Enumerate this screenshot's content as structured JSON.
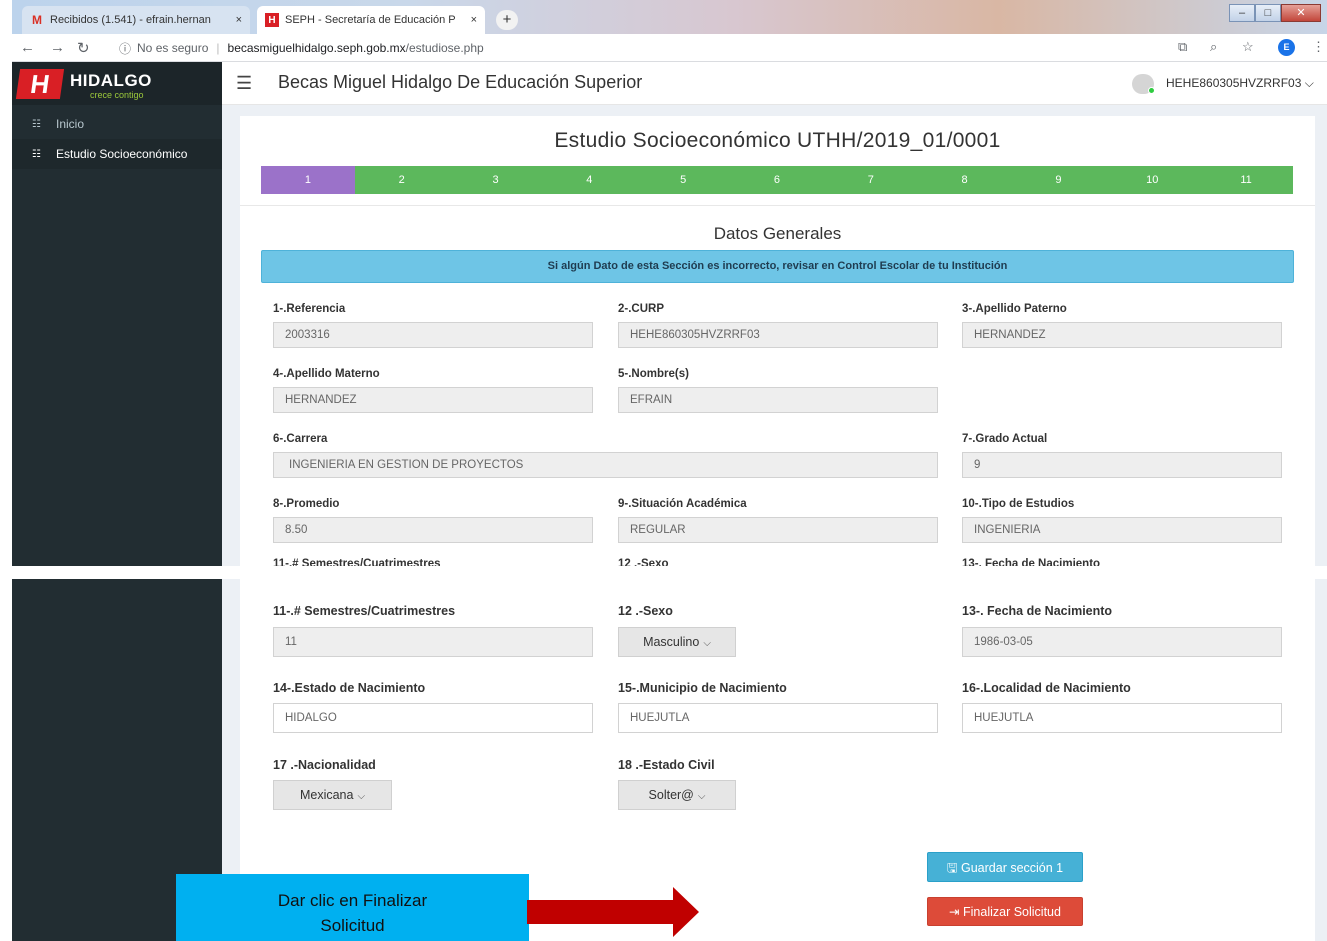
{
  "browser": {
    "tabs": [
      {
        "icon": "gmail-icon",
        "title": "Recibidos (1.541) - efrain.hernan",
        "close": "×"
      },
      {
        "icon": "hidalgo-favicon",
        "title": "SEPH - Secretaría de Educación P",
        "close": "×"
      }
    ],
    "new_tab": "+",
    "window_controls": {
      "minimize": "–",
      "maximize": "□",
      "close": "✕"
    },
    "security": "No es seguro",
    "url_host": "becasmiguelhidalgo.seph.gob.mx",
    "url_path": "/estudiose.php",
    "profile_initial": "E"
  },
  "sidebar": {
    "logo_name": "HIDALGO",
    "logo_letter": "H",
    "logo_tagline": "crece contigo",
    "items": [
      {
        "label": "Inicio",
        "icon": "grid-icon"
      },
      {
        "label": "Estudio Socioeconómico",
        "icon": "grid-icon"
      }
    ]
  },
  "header": {
    "title": "Becas Miguel Hidalgo De Educación Superior",
    "username": "HEHE860305HVZRRF03",
    "user_chevron": "⌵"
  },
  "form": {
    "title": "Estudio Socioeconómico UTHH/2019_01/0001",
    "steps": [
      "1",
      "2",
      "3",
      "4",
      "5",
      "6",
      "7",
      "8",
      "9",
      "10",
      "11"
    ],
    "active_step": "1",
    "section_title": "Datos Generales",
    "alert": "Si algún Dato de esta Sección es incorrecto, revisar en Control Escolar de tu Institución",
    "fields": {
      "referencia": {
        "label": "1-.Referencia",
        "value": "2003316"
      },
      "curp": {
        "label": "2-.CURP",
        "value": "HEHE860305HVZRRF03"
      },
      "apellido_paterno": {
        "label": "3-.Apellido Paterno",
        "value": "HERNANDEZ"
      },
      "apellido_materno": {
        "label": "4-.Apellido Materno",
        "value": "HERNANDEZ"
      },
      "nombre": {
        "label": "5-.Nombre(s)",
        "value": "EFRAIN"
      },
      "carrera": {
        "label": "6-.Carrera",
        "value": "INGENIERIA EN GESTION DE PROYECTOS"
      },
      "grado": {
        "label": "7-.Grado Actual",
        "value": "9"
      },
      "promedio": {
        "label": "8-.Promedio",
        "value": "8.50"
      },
      "situacion": {
        "label": "9-.Situación Académica",
        "value": "REGULAR"
      },
      "tipo_estudios": {
        "label": "10-.Tipo de Estudios",
        "value": "INGENIERIA"
      },
      "semestres": {
        "label": "11-.# Semestres/Cuatrimestres",
        "value": "11"
      },
      "sexo": {
        "label": "12 .-Sexo",
        "value": "Masculino"
      },
      "fecha_nacimiento": {
        "label": "13-. Fecha de Nacimiento",
        "value": "1986-03-05"
      },
      "estado_nacimiento": {
        "label": "14-.Estado de Nacimiento",
        "value": "HIDALGO"
      },
      "municipio_nacimiento": {
        "label": "15-.Municipio de Nacimiento",
        "value": "HUEJUTLA"
      },
      "localidad_nacimiento": {
        "label": "16-.Localidad de Nacimiento",
        "value": "HUEJUTLA"
      },
      "nacionalidad": {
        "label": "17 .-Nacionalidad",
        "value": "Mexicana"
      },
      "estado_civil": {
        "label": "18 .-Estado Civil",
        "value": "Solter@"
      }
    },
    "buttons": {
      "guardar": "Guardar sección 1",
      "finalizar": "Finalizar Solicitud"
    }
  },
  "annotation": {
    "callout_line1": "Dar clic en Finalizar",
    "callout_line2": "Solicitud"
  },
  "colors": {
    "sidebar": "#222d32",
    "step_active": "#9b72c9",
    "step": "#5cb85c",
    "alert": "#6ec5e6",
    "save_button": "#46b1d6",
    "finish_button": "#dd4b39",
    "callout": "#00b0f0",
    "arrow": "#c00000"
  }
}
